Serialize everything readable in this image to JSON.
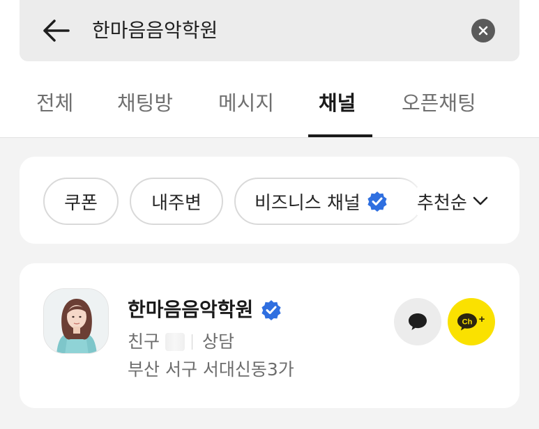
{
  "search": {
    "query": "한마음음악학원"
  },
  "tabs": [
    {
      "label": "전체",
      "active": false
    },
    {
      "label": "채팅방",
      "active": false
    },
    {
      "label": "메시지",
      "active": false
    },
    {
      "label": "채널",
      "active": true
    },
    {
      "label": "오픈채팅",
      "active": false
    }
  ],
  "filters": {
    "chips": [
      {
        "label": "쿠폰"
      },
      {
        "label": "내주변"
      },
      {
        "label": "비즈니스 채널"
      }
    ],
    "sort_label": "추천순"
  },
  "result": {
    "name": "한마음음악학원",
    "friends_label": "친구",
    "consult_label": "상담",
    "address": "부산 서구 서대신동3가",
    "add_channel_icon_text": "Ch+"
  },
  "colors": {
    "verified_blue": "#2f6fe0",
    "kakao_yellow": "#fae100",
    "active_tab": "#1a1a1a"
  },
  "icons": {
    "back": "back-arrow-icon",
    "clear": "clear-icon",
    "verified": "verified-badge-icon",
    "sort": "chevron-down-icon",
    "chat": "chat-bubble-icon",
    "add_channel": "add-channel-icon"
  }
}
